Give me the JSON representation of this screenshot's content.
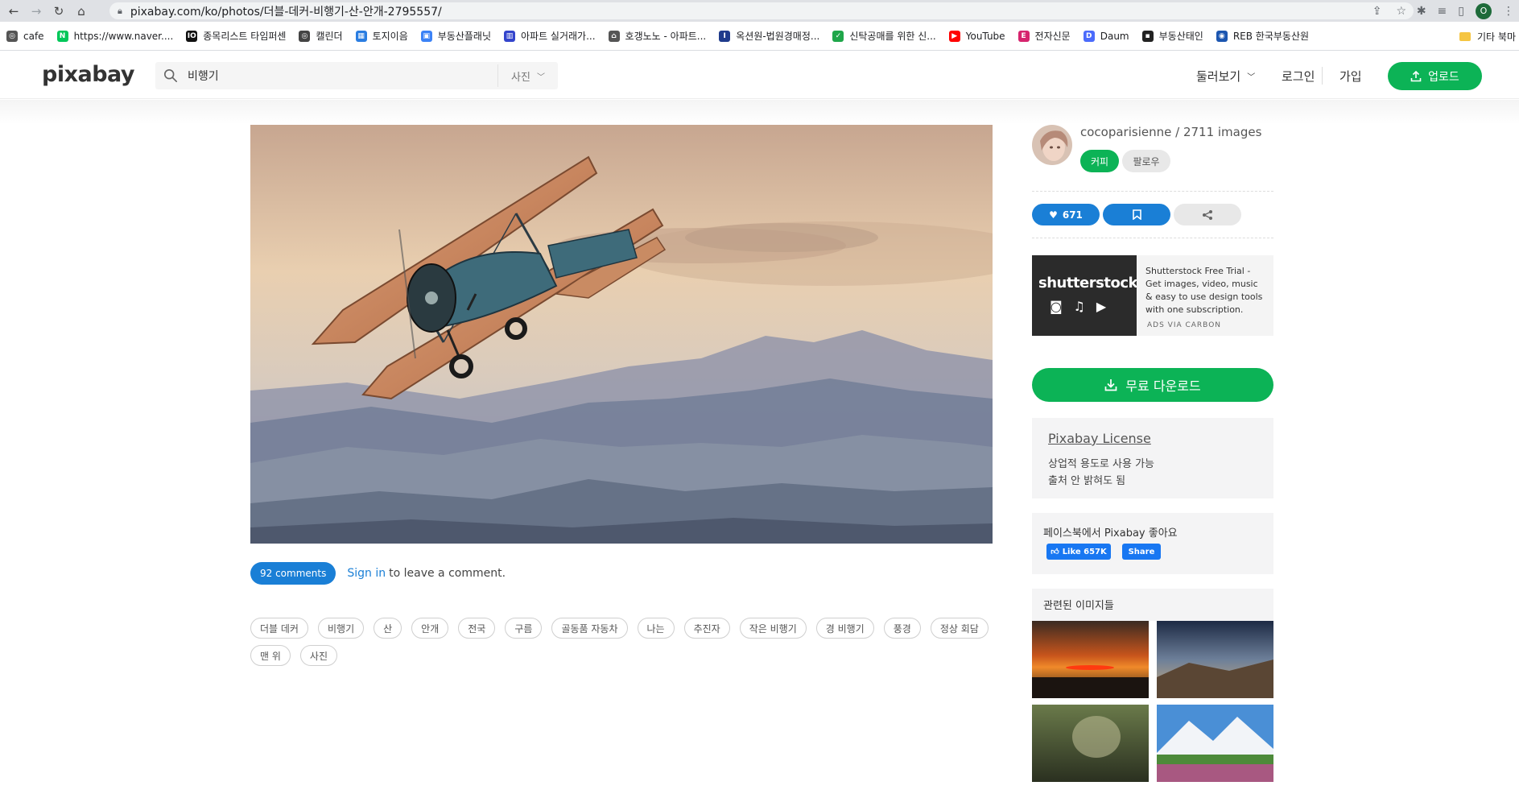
{
  "browser": {
    "url": "pixabay.com/ko/photos/더블-데커-비행기-산-안개-2795557/",
    "profile_initial": "O",
    "bookmarks": [
      {
        "label": "cafe",
        "color": "#555555",
        "glyph": "◎"
      },
      {
        "label": "https://www.naver....",
        "color": "#03c75a",
        "glyph": "N"
      },
      {
        "label": "종목리스트 타임퍼센",
        "color": "#111111",
        "glyph": "IO"
      },
      {
        "label": "캘린더",
        "color": "#444444",
        "glyph": "◎"
      },
      {
        "label": "토지이음",
        "color": "#2a7de1",
        "glyph": "▦"
      },
      {
        "label": "부동산플래닛",
        "color": "#3b82f6",
        "glyph": "▣"
      },
      {
        "label": "아파트 실거래가...",
        "color": "#3344cc",
        "glyph": "▥"
      },
      {
        "label": "호갱노노 - 아파트...",
        "color": "#555555",
        "glyph": "⌂"
      },
      {
        "label": "옥션원-법원경매정...",
        "color": "#1f3b8c",
        "glyph": "I"
      },
      {
        "label": "신탁공매를 위한 신...",
        "color": "#1fa64a",
        "glyph": "✓"
      },
      {
        "label": "YouTube",
        "color": "#ff0000",
        "glyph": "▶"
      },
      {
        "label": "전자신문",
        "color": "#d6246e",
        "glyph": "E"
      },
      {
        "label": "Daum",
        "color": "#4b6bfb",
        "glyph": "D"
      },
      {
        "label": "부동산태인",
        "color": "#222222",
        "glyph": "▪"
      },
      {
        "label": "REB 한국부동산원",
        "color": "#1c56b0",
        "glyph": "◉"
      }
    ],
    "more": "»",
    "other_bookmarks": "기타 북마"
  },
  "header": {
    "logo": "pixabay",
    "search_value": "비행기",
    "search_type": "사진",
    "explore": "둘러보기",
    "login": "로그인",
    "join": "가입",
    "upload": "업로드"
  },
  "photo": {
    "comments_count": "92 comments",
    "sign_in": "Sign in",
    "leave_comment": "to leave a comment.",
    "tags": [
      "더블 데커",
      "비행기",
      "산",
      "안개",
      "전국",
      "구름",
      "골동품 자동차",
      "나는",
      "추진자",
      "작은 비행기",
      "경 비행기",
      "풍경",
      "정상 회담",
      "맨 위",
      "사진"
    ]
  },
  "sidebar": {
    "author": "cocoparisienne / 2711 images",
    "coffee": "커피",
    "follow": "팔로우",
    "likes": "671",
    "ad_logo": "shutterstock",
    "ad_text": "Shutterstock Free Trial - Get images, video, music & easy to use design tools with one subscription.",
    "ad_via": "ADS VIA CARBON",
    "download": "무료 다운로드",
    "license_title": "Pixabay License",
    "license_line1": "상업적 용도로 사용 가능",
    "license_line2": "출처 안 밝혀도 됨",
    "fb_title": "페이스북에서 Pixabay 좋아요",
    "fb_like": "Like 657K",
    "fb_share": "Share",
    "related_title": "관련된 이미지들"
  },
  "colors": {
    "green": "#0cb356",
    "blue": "#1a7fd6"
  }
}
